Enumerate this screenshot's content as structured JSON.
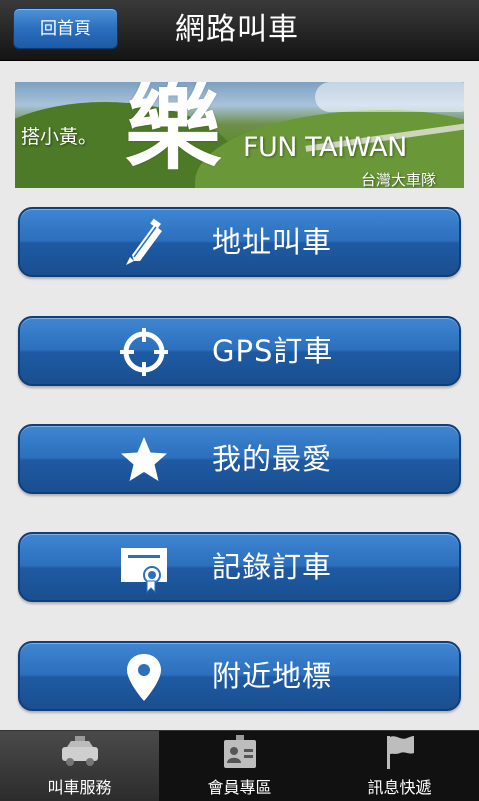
{
  "header": {
    "home_label": "回首頁",
    "title": "網路叫車"
  },
  "banner": {
    "big_char": "樂",
    "slogan": "搭小黃。",
    "fun_text": "FUN TAIWAN",
    "team": "台灣大車隊"
  },
  "menu": {
    "items": [
      {
        "label": "地址叫車",
        "icon": "pencil-icon"
      },
      {
        "label": "GPS訂車",
        "icon": "crosshair-icon"
      },
      {
        "label": "我的最愛",
        "icon": "star-icon"
      },
      {
        "label": "記錄訂車",
        "icon": "certificate-icon"
      },
      {
        "label": "附近地標",
        "icon": "map-pin-icon"
      }
    ]
  },
  "nav": {
    "tabs": [
      {
        "label": "叫車服務",
        "icon": "taxi-icon",
        "active": true
      },
      {
        "label": "會員專區",
        "icon": "member-card-icon",
        "active": false
      },
      {
        "label": "訊息快遞",
        "icon": "flag-icon",
        "active": false
      }
    ]
  },
  "colors": {
    "button_blue": "#2b6fbd",
    "topbar": "#1e1e1e",
    "background": "#e9e9e9"
  }
}
